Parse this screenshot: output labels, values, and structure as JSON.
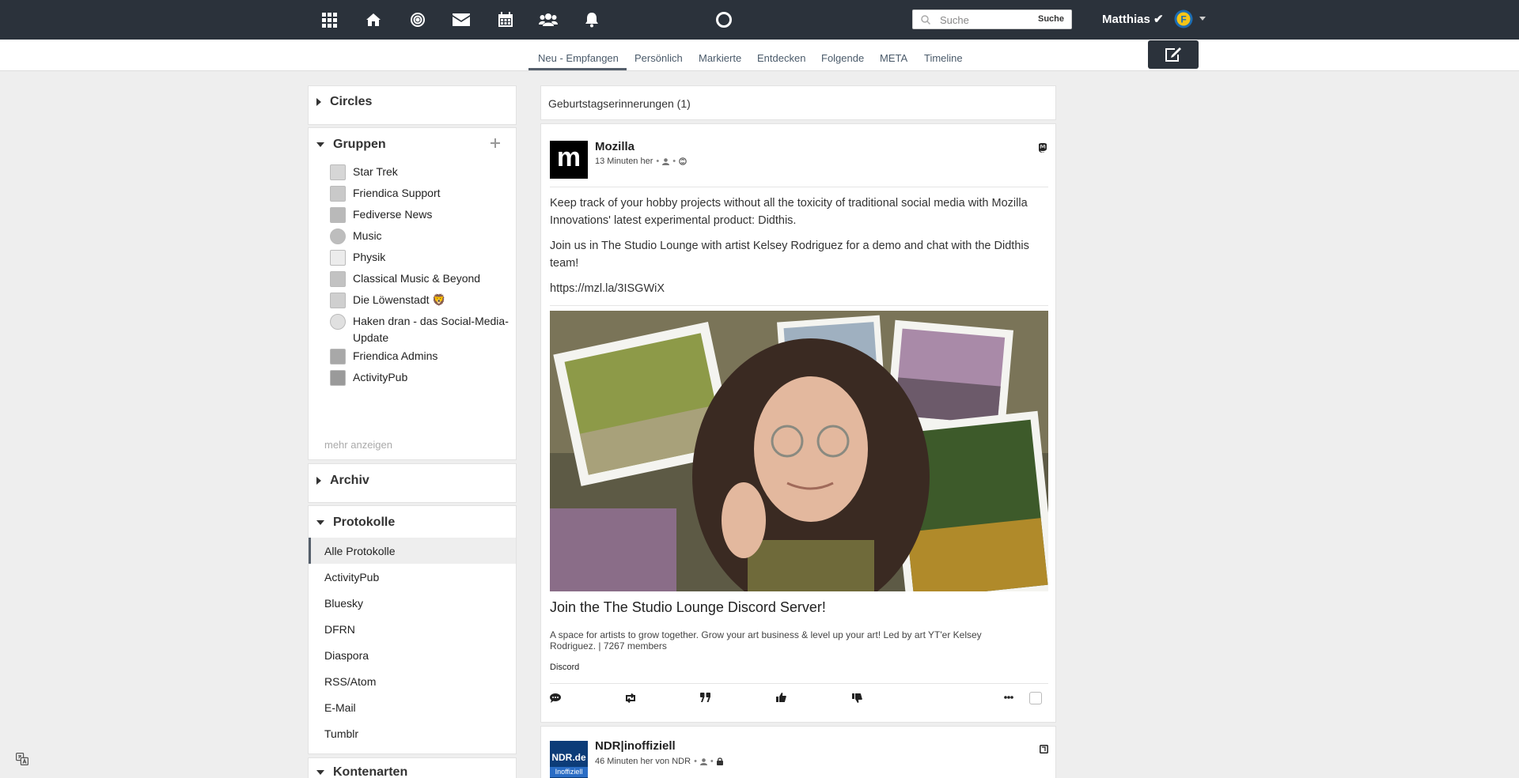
{
  "topbar": {
    "icons": [
      "apps-grid-icon",
      "home-icon",
      "network-target-icon",
      "envelope-icon",
      "calendar-icon",
      "users-icon",
      "bell-icon",
      "circle-logo-icon"
    ],
    "search_placeholder": "Suche",
    "search_button": "Suche",
    "user_name": "Matthias ✔",
    "avatar_letter": "F"
  },
  "tabs": [
    {
      "label": "Neu - Empfangen",
      "active": true
    },
    {
      "label": "Persönlich"
    },
    {
      "label": "Markierte"
    },
    {
      "label": "Entdecken"
    },
    {
      "label": "Folgende"
    },
    {
      "label": "META"
    },
    {
      "label": "Timeline"
    }
  ],
  "sidebar": {
    "circles_title": "Circles",
    "groups_title": "Gruppen",
    "groups": [
      "Star Trek",
      "Friendica Support",
      "Fediverse News",
      "Music",
      "Physik",
      "Classical Music & Beyond",
      "Die Löwenstadt 🦁",
      "Haken dran - das Social-Media-Update",
      "Friendica Admins",
      "ActivityPub"
    ],
    "show_more": "mehr anzeigen",
    "archive_title": "Archiv",
    "protocols_title": "Protokolle",
    "protocols": [
      "Alle Protokolle",
      "ActivityPub",
      "Bluesky",
      "DFRN",
      "Diaspora",
      "RSS/Atom",
      "E-Mail",
      "Tumblr"
    ],
    "account_types_title": "Kontenarten"
  },
  "birthday": "Geburtstagserinnerungen (1)",
  "post1": {
    "author": "Mozilla",
    "avatar_letter": "m",
    "meta": "13 Minuten her",
    "para1": "Keep track of your hobby projects without all the toxicity of traditional social media with Mozilla Innovations' latest experimental product: Didthis.",
    "para2": "Join us in The Studio Lounge with artist Kelsey Rodriguez for a demo and chat with the Didthis team!",
    "link": "https://mzl.la/3ISGWiX",
    "card_title": "Join the The Studio Lounge Discord Server!",
    "card_desc": "A space for artists to grow together. Grow your art business & level up your art! Led by art YT'er Kelsey Rodriguez. | 7267 members",
    "card_source": "Discord"
  },
  "post2": {
    "author": "NDR|inoffiziell",
    "meta": "46 Minuten her von NDR",
    "avatar_text": "NDR.de",
    "avatar_sub": "Inoffiziell"
  },
  "colors": {
    "topbar": "#2b323b",
    "page_bg": "#eeeeee",
    "accent": "#555f6b"
  }
}
